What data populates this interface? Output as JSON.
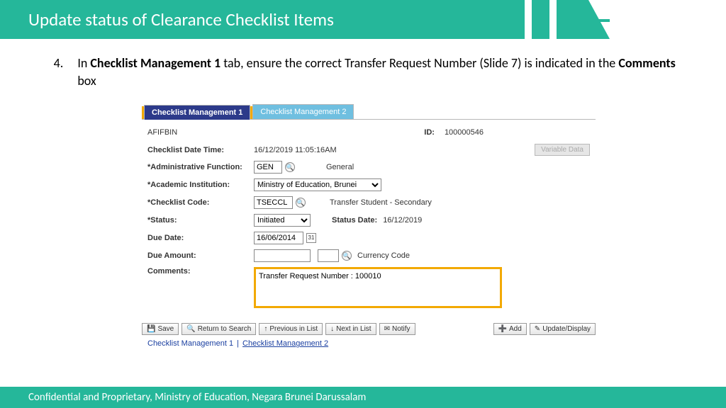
{
  "header": {
    "title": "Update status of Clearance Checklist Items"
  },
  "instruction": {
    "number": "4.",
    "segments": {
      "s1": "In ",
      "b1": "Checklist Management 1",
      "s2": " tab, ensure the correct Transfer Request Number (Slide 7) is indicated in the ",
      "b2": "Comments",
      "s3": " box"
    }
  },
  "tabs": {
    "tab1": "Checklist Management 1",
    "tab2": "Checklist Management 2"
  },
  "form": {
    "name": "AFIFBIN",
    "id_label": "ID:",
    "id_value": "100000546",
    "datetime_label": "Checklist Date Time:",
    "datetime_value": "16/12/2019 11:05:16AM",
    "variable_data_btn": "Variable Data",
    "admin_func_label": "*Administrative Function:",
    "admin_func_value": "GEN",
    "admin_func_text": "General",
    "institution_label": "*Academic Institution:",
    "institution_value": "Ministry of Education, Brunei",
    "code_label": "*Checklist Code:",
    "code_value": "TSECCL",
    "code_text": "Transfer Student - Secondary",
    "status_label": "*Status:",
    "status_value": "Initiated",
    "status_date_label": "Status Date:",
    "status_date_value": "16/12/2019",
    "due_date_label": "Due Date:",
    "due_date_value": "16/06/2014",
    "due_amount_label": "Due Amount:",
    "due_amount_value": "",
    "currency_label": "Currency Code",
    "comments_label": "Comments:",
    "comments_value": "Transfer Request Number : 100010"
  },
  "buttons": {
    "save": "Save",
    "return": "Return to Search",
    "prev": "Previous in List",
    "next": "Next in List",
    "notify": "Notify",
    "add": "Add",
    "update": "Update/Display"
  },
  "footer_links": {
    "link1": "Checklist Management 1",
    "link2": "Checklist Management 2"
  },
  "footer": {
    "text": "Confidential and Proprietary, Ministry of Education, Negara Brunei Darussalam"
  }
}
